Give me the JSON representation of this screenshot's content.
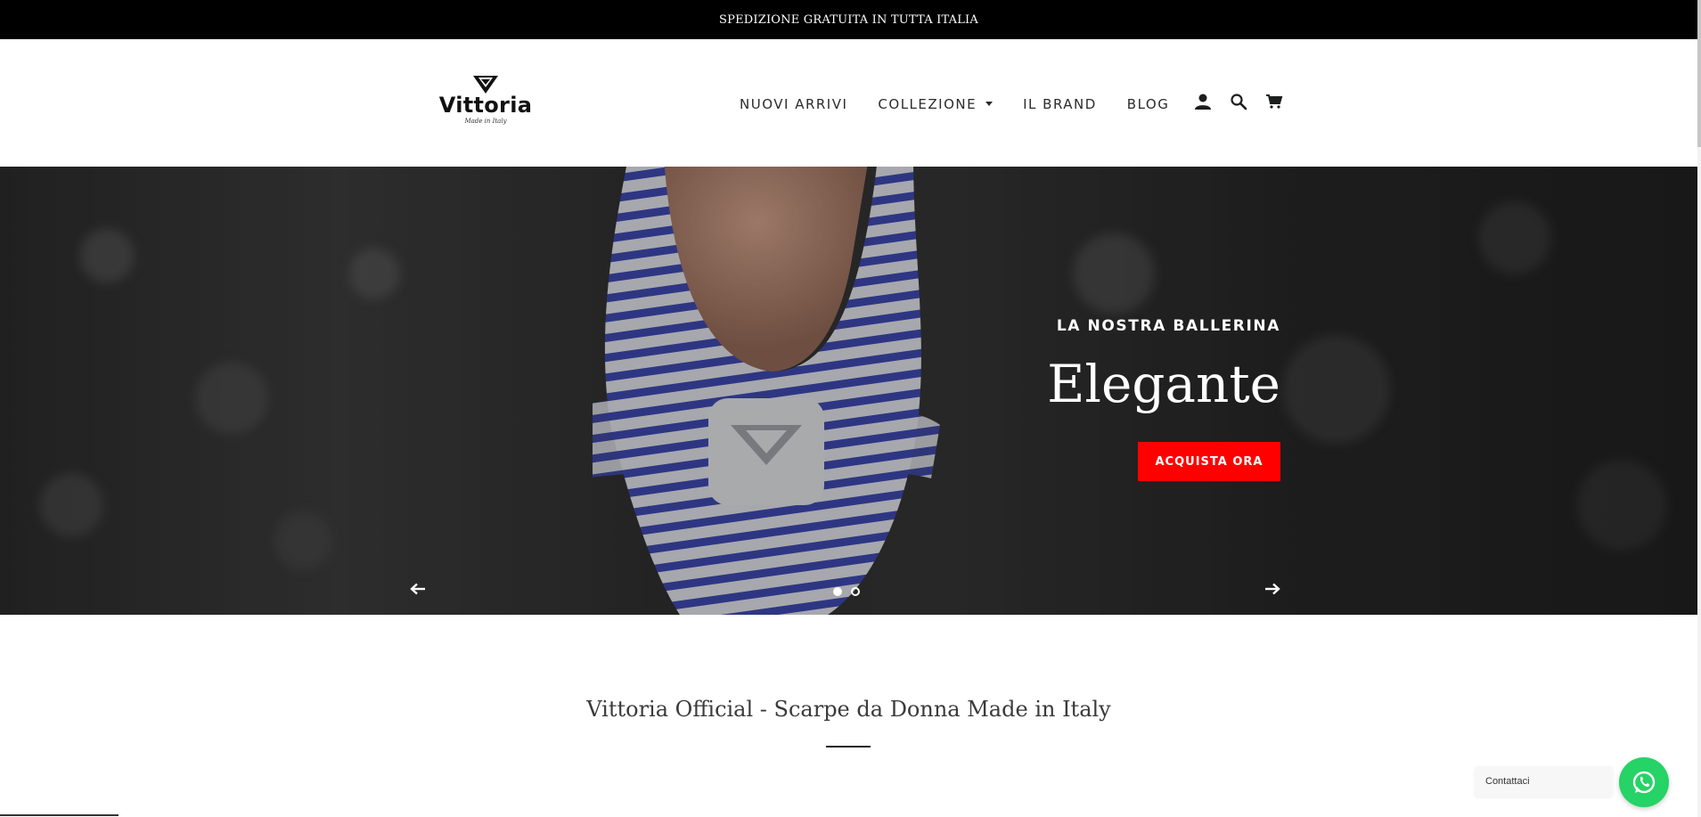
{
  "announcement": "SPEDIZIONE GRATUITA IN TUTTA ITALIA",
  "logo": {
    "word": "Vittoria",
    "tagline": "Made in Italy"
  },
  "nav": {
    "items": [
      "NUOVI ARRIVI",
      "COLLEZIONE",
      "IL BRAND",
      "BLOG"
    ],
    "icons": [
      "account-icon",
      "search-icon",
      "cart-icon"
    ]
  },
  "hero": {
    "subtitle": "LA NOSTRA BALLERINA",
    "title": "Elegante",
    "button": "ACQUISTA ORA",
    "slides": 2,
    "active_slide": 1,
    "button_color": "#ff0000"
  },
  "section": {
    "title": "Vittoria Official - Scarpe da Donna Made in Italy"
  },
  "whatsapp": {
    "label": "Contattaci",
    "color": "#25d366"
  }
}
